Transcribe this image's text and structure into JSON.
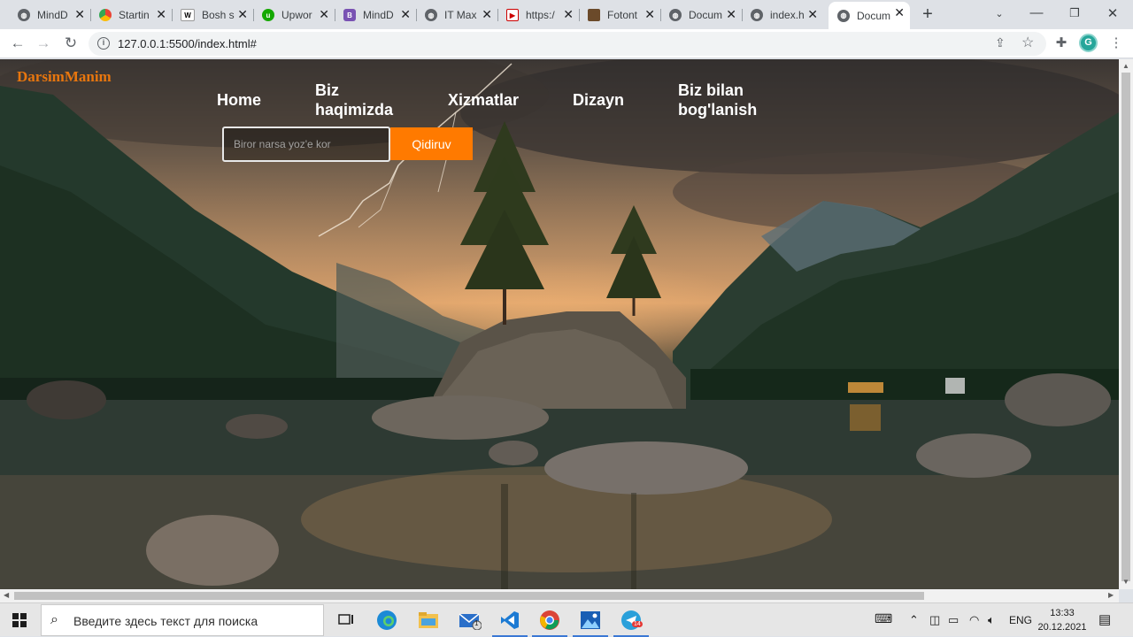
{
  "browser": {
    "tabs": [
      {
        "title": "MindD",
        "icon": "globe-icon"
      },
      {
        "title": "Startin",
        "icon": "chrome-icon"
      },
      {
        "title": "Bosh s",
        "icon": "wix-icon"
      },
      {
        "title": "Upwor",
        "icon": "upwork-icon"
      },
      {
        "title": "MindD",
        "icon": "bootstrap-icon"
      },
      {
        "title": "IT Max",
        "icon": "globe-icon"
      },
      {
        "title": "https:/",
        "icon": "youtube-icon"
      },
      {
        "title": "Fotont",
        "icon": "photo-icon"
      },
      {
        "title": "Docum",
        "icon": "globe-icon"
      },
      {
        "title": "index.h",
        "icon": "globe-icon"
      },
      {
        "title": "Docum",
        "icon": "globe-icon"
      }
    ],
    "active_tab": 10,
    "url": "127.0.0.1:5500/index.html#",
    "profile_letter": "G"
  },
  "page": {
    "logo": "DarsimManim",
    "menu": {
      "home": "Home",
      "about_line1": "Biz",
      "about_line2": "haqimizda",
      "services": "Xizmatlar",
      "design": "Dizayn",
      "contact_line1": "Biz bilan",
      "contact_line2": "bog'lanish"
    },
    "search": {
      "placeholder": "Biror narsa yoz'e kor",
      "button": "Qidiruv"
    },
    "colors": {
      "logo": "#e8760e",
      "button": "#ff7a00",
      "menu_text": "#ffffff"
    }
  },
  "taskbar": {
    "search_placeholder": "Введите здесь текст для поиска",
    "language": "ENG",
    "time": "13:33",
    "date": "20.12.2021",
    "mail_badge": "1",
    "telegram_badge": "14"
  }
}
